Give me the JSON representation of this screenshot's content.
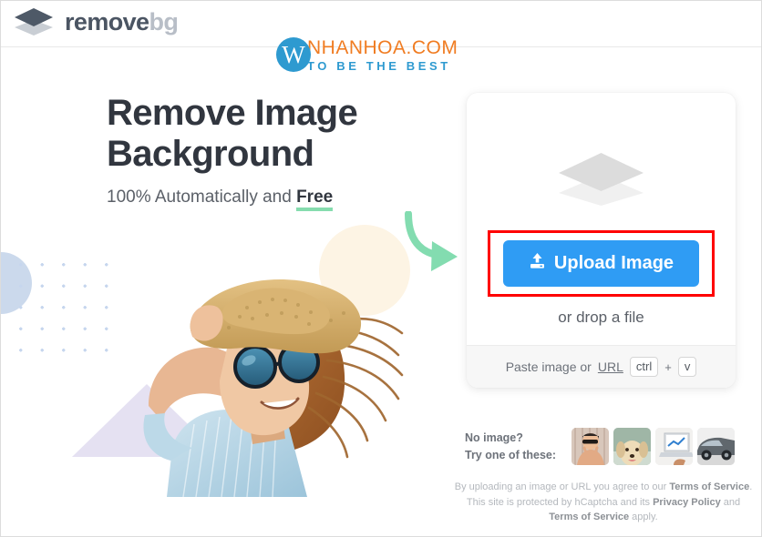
{
  "header": {
    "brand_primary": "remove",
    "brand_secondary": "bg",
    "logo_icon": "stacked-layers-icon"
  },
  "watermark": {
    "monogram": "W",
    "title": "NHANHOA.COM",
    "tagline": "TO BE THE BEST",
    "circle_color": "#2e9ad0",
    "title_color": "#f07c22",
    "tagline_color": "#2e9ad0"
  },
  "hero": {
    "title_line1": "Remove Image",
    "title_line2": "Background",
    "subtitle_prefix": "100% Automatically and ",
    "subtitle_highlight": "Free",
    "highlight_underline_color": "#86dcae",
    "photo_alt": "woman-with-straw-hat-and-sunglasses"
  },
  "decorations": {
    "arrow_color": "#83dcb0",
    "quarter_circle_color": "#cbd9ec",
    "dot_grid_color": "#c6d6ee",
    "cream_circle_color": "#fdf4e4",
    "triangle_color": "#e5e1f2"
  },
  "upload_card": {
    "placeholder_icon": "stacked-layers-icon",
    "button_label": "Upload Image",
    "button_icon": "upload-icon",
    "button_color": "#2f9cf4",
    "highlight_border_color": "#ff0000",
    "drop_text": "or drop a file",
    "paste_text": "Paste image or",
    "paste_link": "URL",
    "key_ctrl": "ctrl",
    "key_plus": "+",
    "key_v": "v"
  },
  "samples": {
    "label_line1": "No image?",
    "label_line2": "Try one of these:",
    "thumbnails": [
      {
        "name": "sample-woman",
        "alt": "woman with sunglasses"
      },
      {
        "name": "sample-dog",
        "alt": "golden retriever dog"
      },
      {
        "name": "sample-laptop",
        "alt": "person using laptop"
      },
      {
        "name": "sample-car",
        "alt": "grey car"
      }
    ]
  },
  "legal": {
    "line1_prefix": "By uploading an image or URL you agree to our ",
    "line1_link": "Terms of Service",
    "line1_suffix": ".",
    "line2_prefix": "This site is protected by hCaptcha and its ",
    "line2_link": "Privacy Policy",
    "line2_suffix": " and",
    "line3_link": "Terms of Service",
    "line3_suffix": " apply."
  }
}
